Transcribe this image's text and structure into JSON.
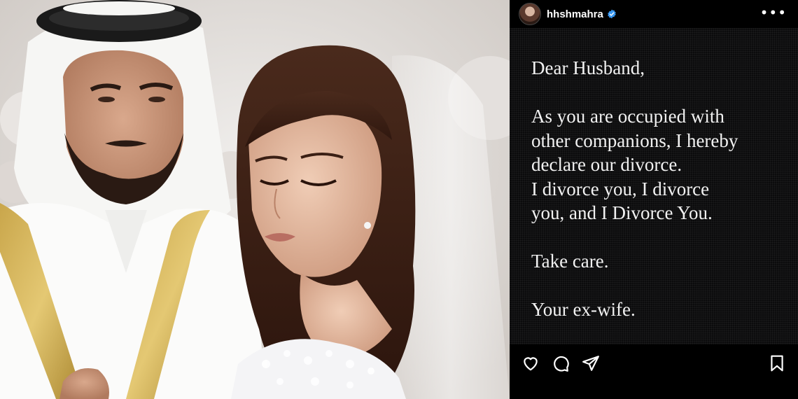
{
  "photo": {
    "description_icon": "wedding-photo"
  },
  "post": {
    "header": {
      "username": "hhshmahra",
      "verified_icon": "verified-badge-icon",
      "more_icon": "more-options-icon",
      "more_glyph": "•••"
    },
    "letter": {
      "greeting": "Dear Husband,",
      "line1": "As you are occupied with",
      "line2": "other companions, I hereby",
      "line3": "declare our divorce.",
      "line4": "I divorce you, I divorce",
      "line5": "you, and I Divorce You.",
      "closing": "Take care.",
      "signature": "Your ex-wife."
    },
    "actions": {
      "like_icon": "heart-icon",
      "comment_icon": "comment-icon",
      "share_icon": "send-icon",
      "save_icon": "bookmark-icon"
    }
  },
  "colors": {
    "post_background": "#0b0b0c",
    "text": "#f2f2f2",
    "verified": "#3897f0"
  }
}
